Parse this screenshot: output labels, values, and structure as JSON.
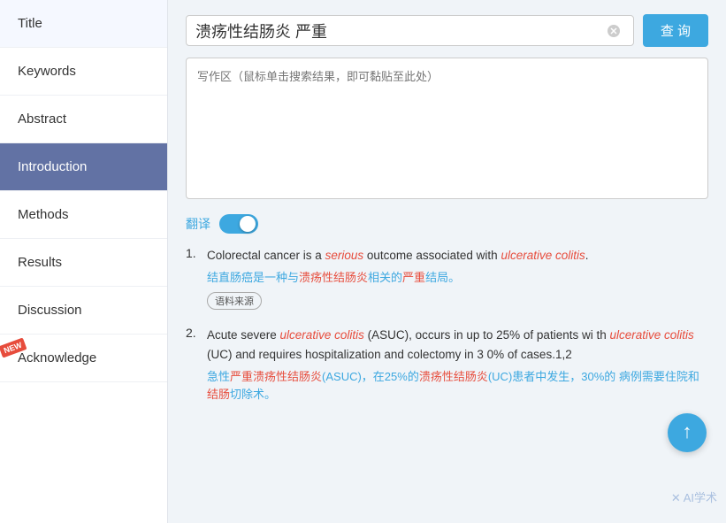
{
  "sidebar": {
    "items": [
      {
        "id": "title",
        "label": "Title",
        "active": false,
        "new": false
      },
      {
        "id": "keywords",
        "label": "Keywords",
        "active": false,
        "new": false
      },
      {
        "id": "abstract",
        "label": "Abstract",
        "active": false,
        "new": false
      },
      {
        "id": "introduction",
        "label": "Introduction",
        "active": true,
        "new": false
      },
      {
        "id": "methods",
        "label": "Methods",
        "active": false,
        "new": false
      },
      {
        "id": "results",
        "label": "Results",
        "active": false,
        "new": false
      },
      {
        "id": "discussion",
        "label": "Discussion",
        "active": false,
        "new": false
      },
      {
        "id": "acknowledge",
        "label": "Acknowledge",
        "active": false,
        "new": true
      }
    ]
  },
  "search": {
    "value": "溃疡性结肠炎 严重",
    "placeholder": "写作区（鼠标单击搜索结果，即可黏贴至此处）",
    "query_btn": "查 询"
  },
  "translate": {
    "label": "翻译"
  },
  "new_badge": "NEW",
  "results": [
    {
      "number": "1.",
      "en_parts": [
        {
          "text": "Colorectal cancer is a ",
          "style": "normal"
        },
        {
          "text": "serious",
          "style": "red-italic"
        },
        {
          "text": " outcome associated with ",
          "style": "normal"
        },
        {
          "text": "ulcerative colitis",
          "style": "red-italic"
        },
        {
          "text": ".",
          "style": "normal"
        }
      ],
      "zh_parts": [
        {
          "text": "结直肠癌是一种与",
          "style": "normal-blue"
        },
        {
          "text": "溃疡性结肠炎",
          "style": "red"
        },
        {
          "text": "相关的",
          "style": "normal-blue"
        },
        {
          "text": "严重",
          "style": "red"
        },
        {
          "text": "结局。",
          "style": "normal-blue"
        }
      ],
      "source": "语料来源"
    },
    {
      "number": "2.",
      "en_parts": [
        {
          "text": "Acute severe ",
          "style": "normal"
        },
        {
          "text": "ulcerative colitis",
          "style": "red-italic"
        },
        {
          "text": " (ASUC), occurs in up to 25% of patients wi\nth ",
          "style": "normal"
        },
        {
          "text": "ulcerative colitis",
          "style": "red-italic"
        },
        {
          "text": " (UC) and requires hospitalization and colectomy in 3\n0% of cases.1,2",
          "style": "normal"
        }
      ],
      "zh_parts": [
        {
          "text": "急性",
          "style": "normal-blue"
        },
        {
          "text": "严重溃疡性结肠炎",
          "style": "red"
        },
        {
          "text": "(ASUC)，在25%的",
          "style": "normal-blue"
        },
        {
          "text": "溃疡性结肠炎",
          "style": "red"
        },
        {
          "text": "(UC)患者中发生，30%的\n病例需要住院和",
          "style": "normal-blue"
        },
        {
          "text": "结肠",
          "style": "red"
        },
        {
          "text": "切除术。",
          "style": "normal-blue"
        }
      ],
      "source": null
    }
  ],
  "watermark": "✕ AI学术"
}
